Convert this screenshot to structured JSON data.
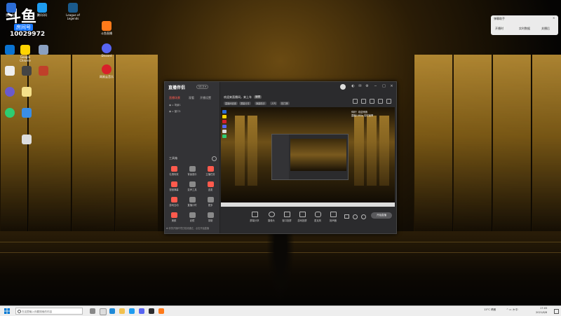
{
  "desktop": {
    "overlay_logo": "斗鱼",
    "room_tag": "房间号",
    "room_id": "10029972",
    "icons": [
      {
        "name": "icon-1",
        "label": "我的电脑",
        "color": "#2b6cd6"
      },
      {
        "name": "icon-2",
        "label": "腾讯QQ",
        "color": "#1e9cf0"
      },
      {
        "name": "icon-3",
        "label": "League of Legends",
        "color": "#1a5a8c"
      },
      {
        "name": "icon-4",
        "label": "斗鱼直播",
        "color": "#ff7a1a"
      },
      {
        "name": "icon-5",
        "label": "Discord",
        "color": "#5865f2"
      },
      {
        "name": "icon-6",
        "label": "网易云音乐",
        "color": "#d8202a"
      },
      {
        "name": "icon-7",
        "label": "Google Chrome",
        "color": "#ffd400"
      }
    ]
  },
  "notification": {
    "title": "弹幕助手",
    "close": "×",
    "row1": "开播时",
    "row2": "实时数据",
    "row3": "关播后"
  },
  "app": {
    "logo": "直播伴侣",
    "badge": "V4.0 ▾",
    "tabs": [
      "直播场景",
      "观看",
      "开播设置"
    ],
    "scenes": [
      "场景1",
      "窗口1"
    ],
    "stream_title": "欢迎来直播间，来上车",
    "edit_label": "编辑",
    "chips": [
      "直播间设置",
      "屏幕分享",
      "弹幕助手",
      "人气",
      "热门榜"
    ],
    "live_info_line1": "你好！欢迎来我",
    "live_info_line2": "直播1080p 实时帧率",
    "tools_title": "工具箱",
    "tools": [
      {
        "name": "tool-gift",
        "label": "礼物特效",
        "grey": false
      },
      {
        "name": "tool-music",
        "label": "背景音乐",
        "grey": true
      },
      {
        "name": "tool-danmu",
        "label": "主播任务",
        "grey": false
      },
      {
        "name": "tool-camera",
        "label": "视频弹幕",
        "grey": false
      },
      {
        "name": "tool-voice",
        "label": "变声工具",
        "grey": true
      },
      {
        "name": "tool-link",
        "label": "连麦",
        "grey": false
      },
      {
        "name": "tool-pk",
        "label": "游戏互动",
        "grey": false
      },
      {
        "name": "tool-timer",
        "label": "直播计时",
        "grey": true
      },
      {
        "name": "tool-more",
        "label": "更多",
        "grey": true
      },
      {
        "name": "tool-beauty",
        "label": "美颜",
        "grey": false
      },
      {
        "name": "tool-filter",
        "label": "滤镜",
        "grey": true
      },
      {
        "name": "tool-record",
        "label": "录制",
        "grey": true
      }
    ],
    "bottom_hint": "✿ 你的开播环境已检测通过，点击开始直播",
    "controls": [
      "屏幕分享",
      "摄像头",
      "窗口投屏",
      "游戏投屏",
      "麦克风",
      "扬声器"
    ],
    "start_label": "开始直播"
  },
  "taskbar": {
    "search_placeholder": "在这里输入你要搜索的内容",
    "weather": "13°C 晴朗",
    "time": "17:05",
    "date": "2021/6/8"
  }
}
